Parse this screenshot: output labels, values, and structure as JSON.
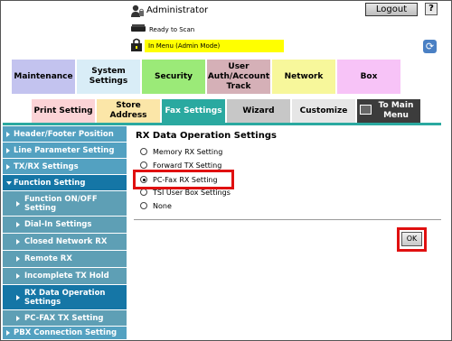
{
  "header": {
    "user_label": "Administrator",
    "logout_label": "Logout",
    "help_label": "?",
    "status_label": "Ready to Scan",
    "mode_label": "In Menu (Admin Mode)"
  },
  "top_tabs": [
    {
      "label": "Maintenance"
    },
    {
      "label": "System Settings"
    },
    {
      "label": "Security"
    },
    {
      "label": "User Auth/Account Track"
    },
    {
      "label": "Network"
    },
    {
      "label": "Box"
    }
  ],
  "sub_tabs": [
    {
      "label": "Print Setting"
    },
    {
      "label": "Store Address"
    },
    {
      "label": "Fax Settings"
    },
    {
      "label": "Wizard"
    },
    {
      "label": "Customize"
    },
    {
      "label": "To Main Menu"
    }
  ],
  "sidebar": {
    "items": [
      {
        "label": "Header/Footer Position"
      },
      {
        "label": "Line Parameter Setting"
      },
      {
        "label": "TX/RX Settings"
      },
      {
        "label": "Function Setting"
      },
      {
        "label": "Function ON/OFF Setting"
      },
      {
        "label": "Dial-In Settings"
      },
      {
        "label": "Closed Network RX"
      },
      {
        "label": "Remote RX"
      },
      {
        "label": "Incomplete TX Hold"
      },
      {
        "label": "RX Data Operation Settings"
      },
      {
        "label": "PC-FAX TX Setting"
      },
      {
        "label": "PBX Connection Setting"
      }
    ]
  },
  "main": {
    "title": "RX Data Operation Settings",
    "options": [
      {
        "label": "Memory RX Setting",
        "selected": false
      },
      {
        "label": "Forward TX Setting",
        "selected": false
      },
      {
        "label": "PC-Fax RX Setting",
        "selected": true
      },
      {
        "label": "TSI User Box Settings",
        "selected": false
      },
      {
        "label": "None",
        "selected": false
      }
    ],
    "ok_label": "OK"
  },
  "colors": {
    "active_tab": "#2aa9a0",
    "sidebar_active": "#1576a6",
    "mode_bar": "#ffff00",
    "highlight": "#e01010"
  }
}
